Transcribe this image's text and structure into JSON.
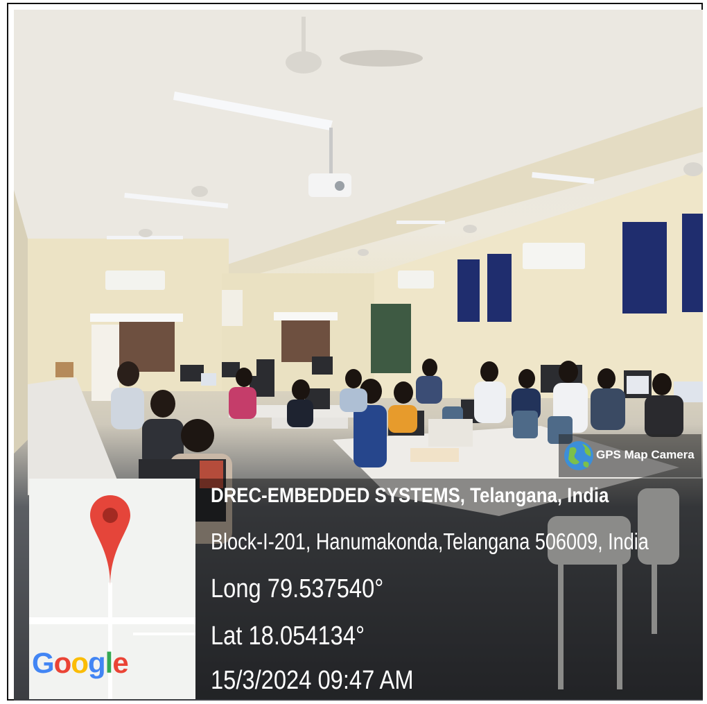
{
  "photo": {
    "subject": "computer-lab-classroom",
    "colors": {
      "ceiling": "#e9e6df",
      "wall": "#ece4c8",
      "floor": "#45474c",
      "poster": "#1f2d6e"
    }
  },
  "map": {
    "logo_text": "Google",
    "pin_color": "#e5453a"
  },
  "badge": {
    "label": "GPS Map Camera"
  },
  "location": {
    "title": "DREC-EMBEDDED SYSTEMS, Telangana, India",
    "address": "Block-I-201, Hanumakonda,Telangana 506009, India",
    "longitude": "Long 79.537540°",
    "latitude": "Lat 18.054134°",
    "timestamp": "15/3/2024 09:47 AM"
  }
}
